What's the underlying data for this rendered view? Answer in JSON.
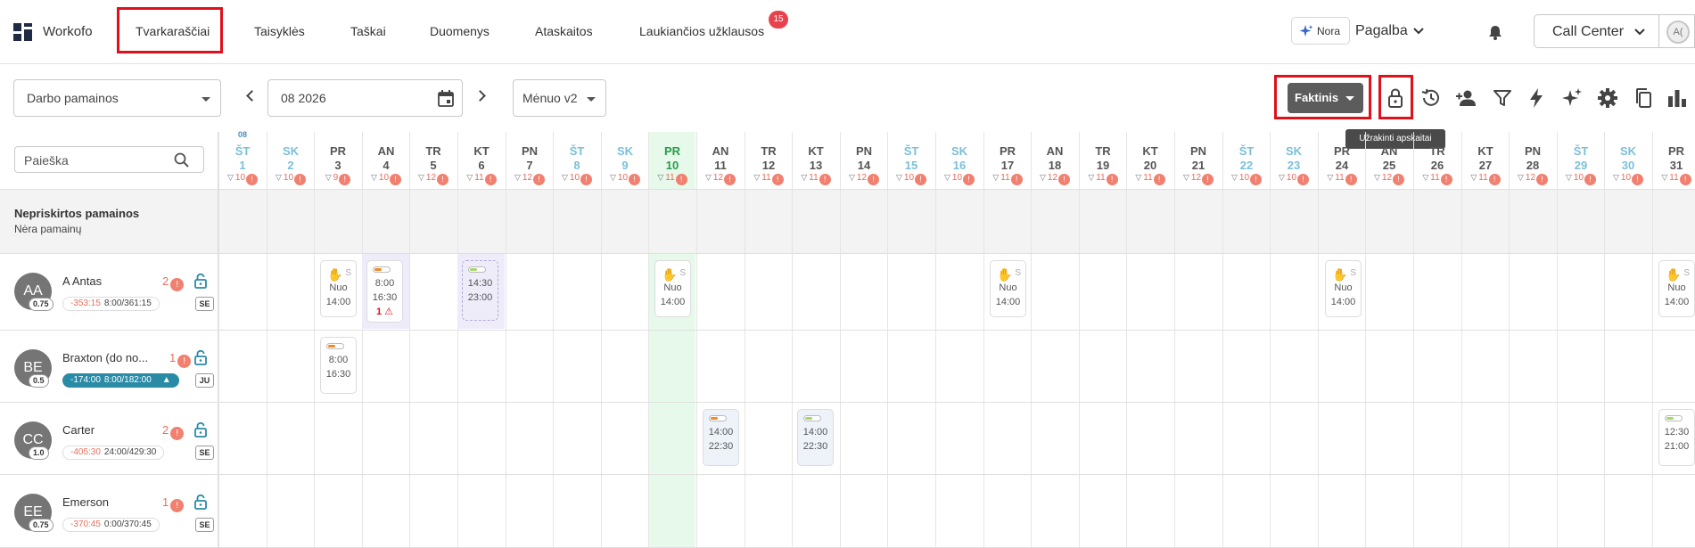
{
  "nav": {
    "brand": "Workofo",
    "items": [
      "Tvarkaraščiai",
      "Taisyklės",
      "Taškai",
      "Duomenys",
      "Ataskaitos",
      "Laukiančios užklausos"
    ],
    "badge": "15",
    "nora": "Nora",
    "help": "Pagalba",
    "workspace": "Call Center",
    "avatar": "A("
  },
  "toolbar": {
    "view_select": "Darbo pamainos",
    "date": "08 2026",
    "mode_select": "Mėnuo v2",
    "faktinis": "Faktinis",
    "tooltip": "Užrakinti apskaitai"
  },
  "search": {
    "placeholder": "Paieška"
  },
  "unassigned": {
    "title": "Nepriskirtos pamainos",
    "subtitle": "Nėra pamainų"
  },
  "month_marker": "08",
  "days": [
    {
      "n": "ŠT",
      "d": "1",
      "c": "10",
      "wk": true
    },
    {
      "n": "SK",
      "d": "2",
      "c": "10",
      "wk": true
    },
    {
      "n": "PR",
      "d": "3",
      "c": "9"
    },
    {
      "n": "AN",
      "d": "4",
      "c": "10"
    },
    {
      "n": "TR",
      "d": "5",
      "c": "12"
    },
    {
      "n": "KT",
      "d": "6",
      "c": "11"
    },
    {
      "n": "PN",
      "d": "7",
      "c": "12"
    },
    {
      "n": "ŠT",
      "d": "8",
      "c": "10",
      "wk": true
    },
    {
      "n": "SK",
      "d": "9",
      "c": "10",
      "wk": true
    },
    {
      "n": "PR",
      "d": "10",
      "c": "11",
      "today": true
    },
    {
      "n": "AN",
      "d": "11",
      "c": "12"
    },
    {
      "n": "TR",
      "d": "12",
      "c": "11"
    },
    {
      "n": "KT",
      "d": "13",
      "c": "11"
    },
    {
      "n": "PN",
      "d": "14",
      "c": "12"
    },
    {
      "n": "ŠT",
      "d": "15",
      "c": "10",
      "wk": true
    },
    {
      "n": "SK",
      "d": "16",
      "c": "10",
      "wk": true
    },
    {
      "n": "PR",
      "d": "17",
      "c": "11"
    },
    {
      "n": "AN",
      "d": "18",
      "c": "12"
    },
    {
      "n": "TR",
      "d": "19",
      "c": "11"
    },
    {
      "n": "KT",
      "d": "20",
      "c": "11"
    },
    {
      "n": "PN",
      "d": "21",
      "c": "12"
    },
    {
      "n": "ŠT",
      "d": "22",
      "c": "10",
      "wk": true
    },
    {
      "n": "SK",
      "d": "23",
      "c": "10",
      "wk": true
    },
    {
      "n": "PR",
      "d": "24",
      "c": "11"
    },
    {
      "n": "AN",
      "d": "25",
      "c": "12"
    },
    {
      "n": "TR",
      "d": "26",
      "c": "11"
    },
    {
      "n": "KT",
      "d": "27",
      "c": "11"
    },
    {
      "n": "PN",
      "d": "28",
      "c": "12"
    },
    {
      "n": "ŠT",
      "d": "29",
      "c": "10",
      "wk": true
    },
    {
      "n": "SK",
      "d": "30",
      "c": "10",
      "wk": true
    },
    {
      "n": "PR",
      "d": "31",
      "c": "11"
    }
  ],
  "employees": [
    {
      "initials": "AA",
      "fte": "0.75",
      "name": "A Antas",
      "warn": "2",
      "neg": "-353:15",
      "hours": "8:00/361:15",
      "role": "SE",
      "dark": false
    },
    {
      "initials": "BE",
      "fte": "0.5",
      "name": "Braxton (do no...",
      "warn": "1",
      "neg": "-174:00",
      "hours": "8:00/182:00",
      "role": "JU",
      "dark": true
    },
    {
      "initials": "CC",
      "fte": "1.0",
      "name": "Carter",
      "warn": "2",
      "neg": "-405:30",
      "hours": "24:00/429:30",
      "role": "SE",
      "dark": false
    },
    {
      "initials": "EE",
      "fte": "0.75",
      "name": "Emerson",
      "warn": "1",
      "neg": "-370:45",
      "hours": "0:00/370:45",
      "role": "SE",
      "dark": false
    }
  ],
  "shifts": {
    "from_label": "Nuo",
    "a_antas_day4": {
      "start": "8:00",
      "end": "16:30",
      "alert": "1"
    },
    "a_antas_day6": {
      "start": "14:30",
      "end": "23:00"
    },
    "avail_time": "14:00",
    "avail_marker": "S",
    "braxton_day3": {
      "start": "8:00",
      "end": "16:30"
    },
    "carter_day11": {
      "start": "14:00",
      "end": "22:30"
    },
    "carter_day13": {
      "start": "14:00",
      "end": "22:30"
    },
    "carter_day31": {
      "start": "12:30",
      "end": "21:00"
    }
  },
  "colors": {
    "accent_red": "#e0101a",
    "today": "#2a9a4a",
    "weekend": "#7ac0d8",
    "warn": "#f08070",
    "teal": "#2a8ba7"
  }
}
